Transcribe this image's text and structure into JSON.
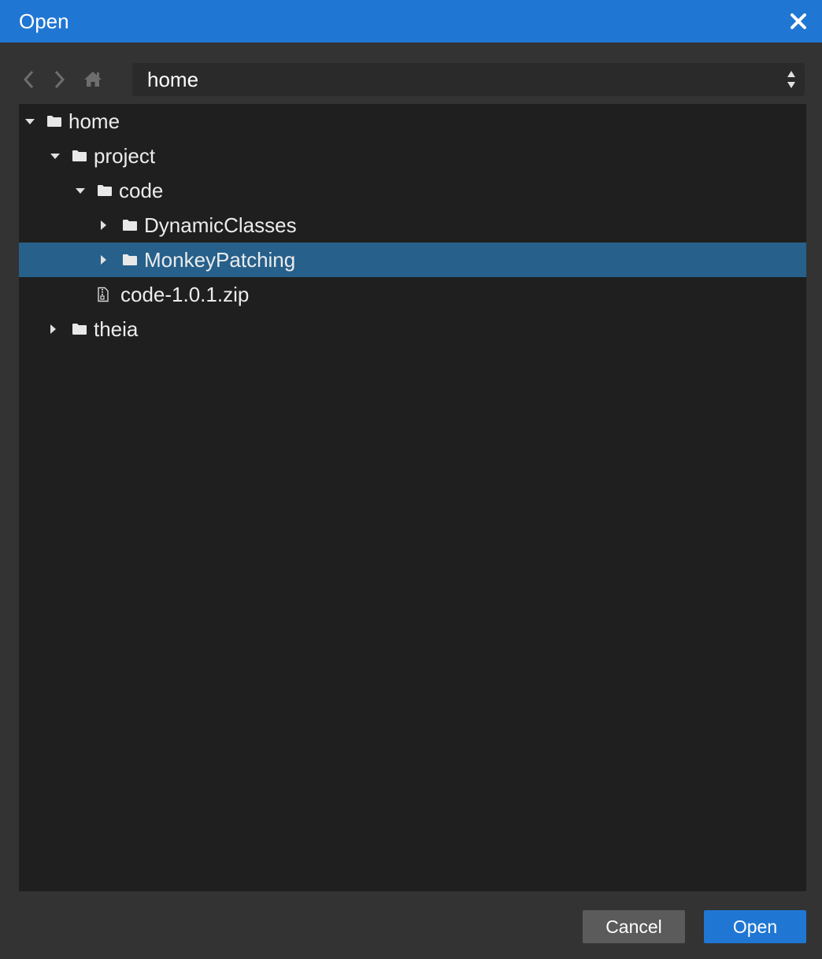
{
  "dialog": {
    "title": "Open"
  },
  "navigation": {
    "location": "home"
  },
  "tree": {
    "items": [
      {
        "label": "home",
        "kind": "folder",
        "expanded": true
      },
      {
        "label": "project",
        "kind": "folder",
        "expanded": true
      },
      {
        "label": "code",
        "kind": "folder",
        "expanded": true
      },
      {
        "label": "DynamicClasses",
        "kind": "folder",
        "expanded": false
      },
      {
        "label": "MonkeyPatching",
        "kind": "folder",
        "expanded": false,
        "selected": true
      },
      {
        "label": "code-1.0.1.zip",
        "kind": "file"
      },
      {
        "label": "theia",
        "kind": "folder",
        "expanded": false
      }
    ]
  },
  "footer": {
    "cancel_label": "Cancel",
    "open_label": "Open"
  },
  "colors": {
    "accent": "#2076d3",
    "selection": "#26608b",
    "background": "#333333",
    "tree_background": "#1f1f1f"
  }
}
